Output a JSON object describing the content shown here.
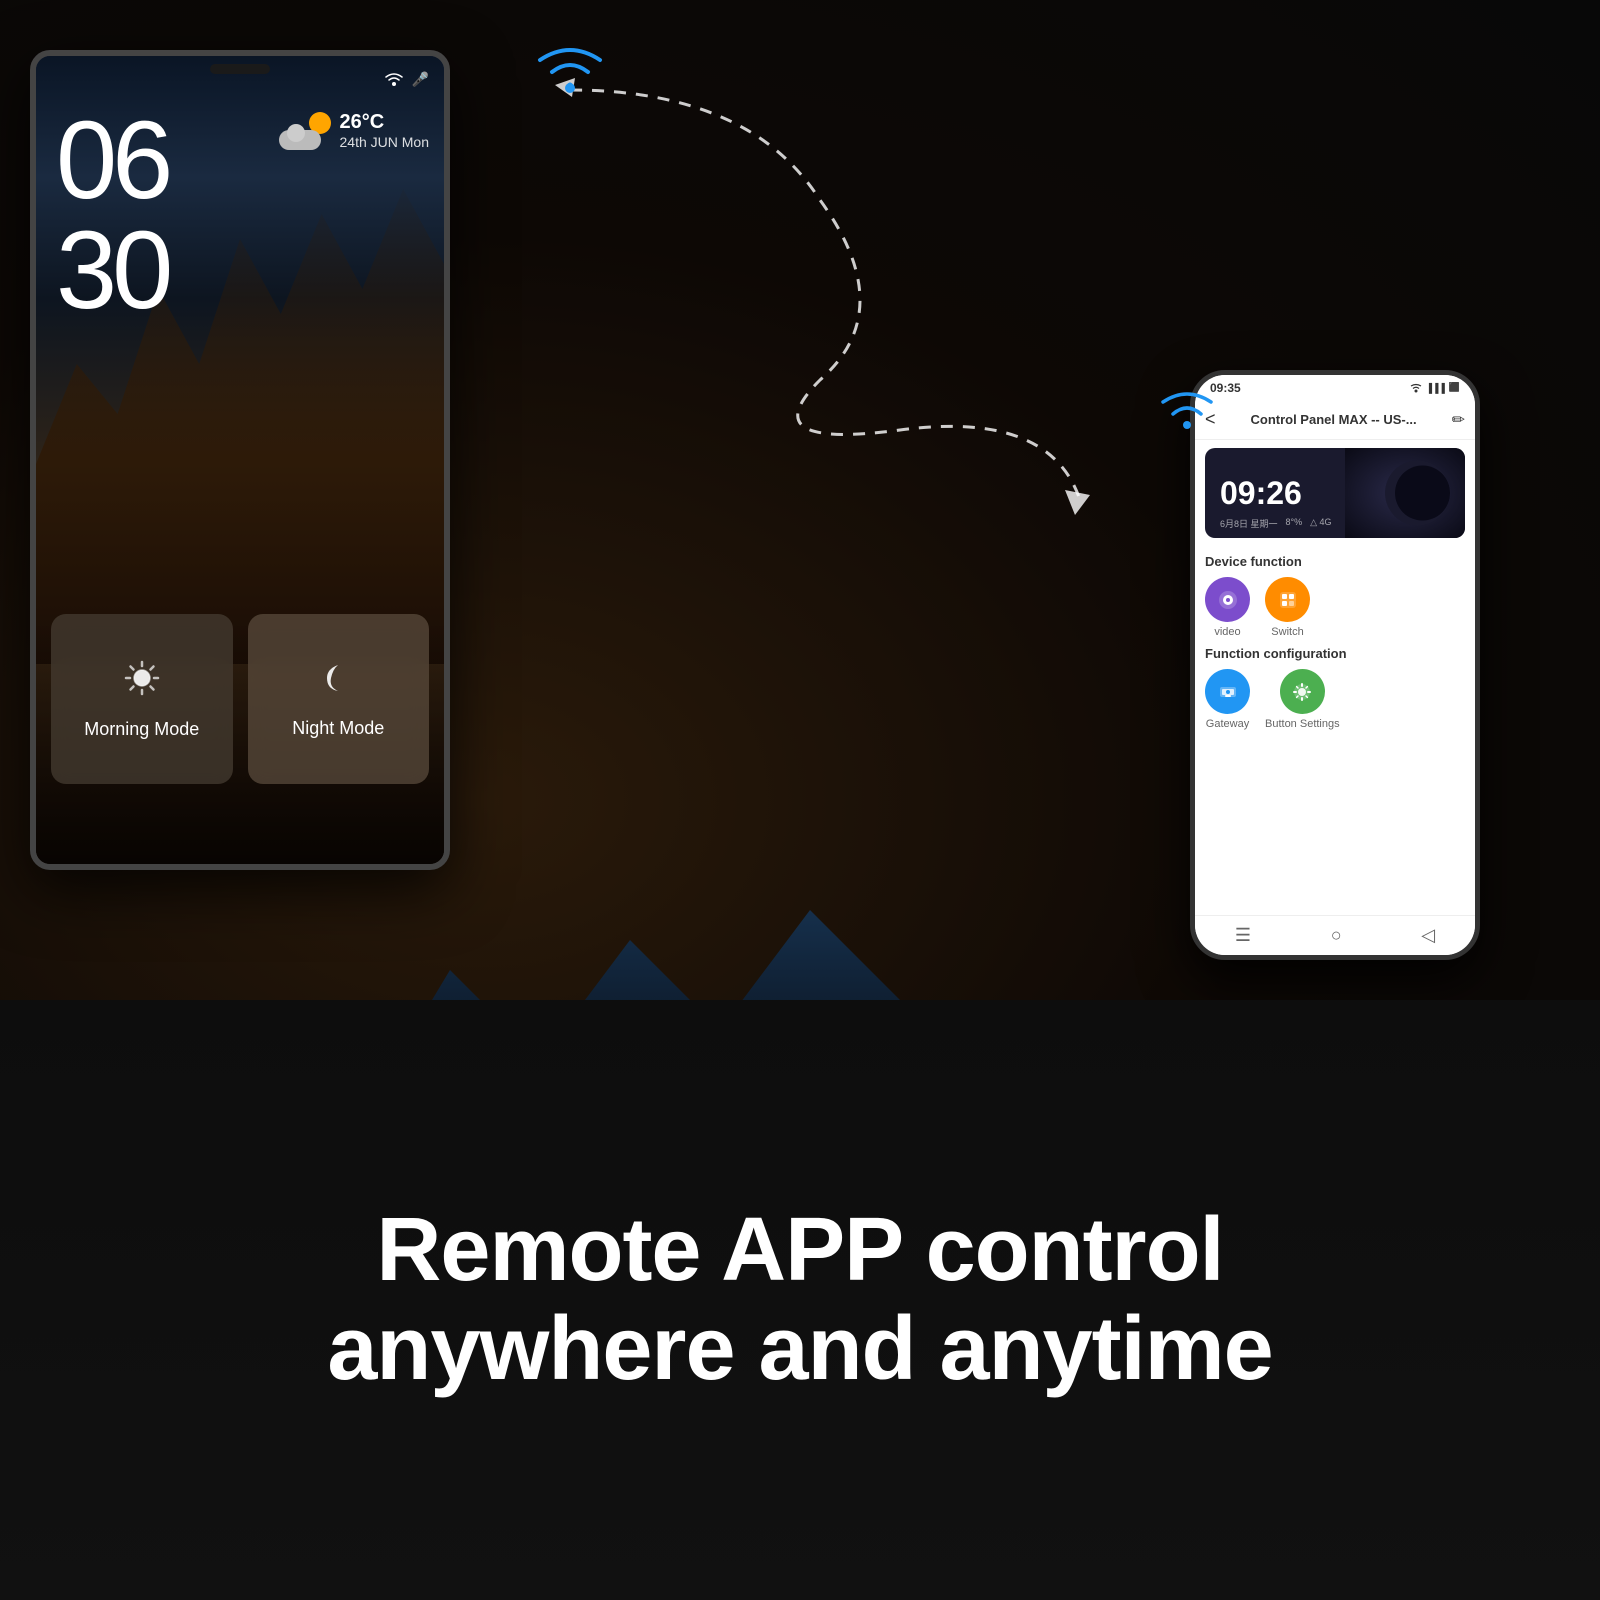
{
  "background": {
    "color": "#1a1a1a"
  },
  "tablet": {
    "time_hours": "06",
    "time_minutes": "30",
    "weather_temp": "26°C",
    "weather_date": "24th JUN  Mon",
    "morning_mode_label": "Morning Mode",
    "night_mode_label": "Night Mode",
    "morning_icon": "☀",
    "night_icon": "🌙"
  },
  "phone": {
    "status_time": "09:35",
    "header_title": "Control Panel MAX -- US-...",
    "clock_time": "09:26",
    "clock_date_parts": [
      "6月8日  星期一",
      "8°%",
      "△ 4G"
    ],
    "device_function_label": "Device function",
    "function_config_label": "Function configuration",
    "items": [
      {
        "label": "video",
        "icon": "📹",
        "color": "purple"
      },
      {
        "label": "Switch",
        "icon": "⏰",
        "color": "orange"
      },
      {
        "label": "Gateway",
        "icon": "🌐",
        "color": "blue"
      },
      {
        "label": "Button Settings",
        "icon": "⚙",
        "color": "green"
      }
    ]
  },
  "bottom_text": {
    "line1": "Remote APP control",
    "line2": "anywhere and anytime"
  },
  "wifi_icon": "📶",
  "arrow_color": "#ffffff"
}
